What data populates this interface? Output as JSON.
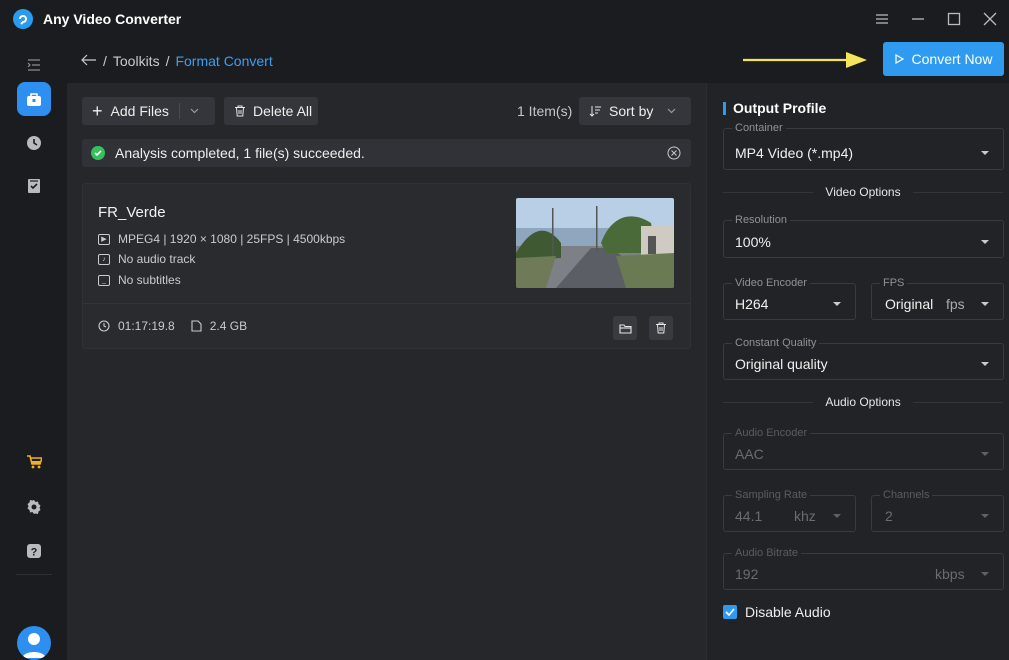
{
  "app": {
    "title": "Any Video Converter"
  },
  "header": {
    "breadcrumb": [
      "Toolkits",
      "Format Convert"
    ],
    "separator": "/",
    "convert_label": "Convert Now"
  },
  "toolbar": {
    "add_files": "Add Files",
    "delete_all": "Delete All",
    "items_count": "1 Item(s)",
    "sort_by": "Sort by"
  },
  "status": {
    "message": "Analysis completed, 1 file(s) succeeded."
  },
  "file": {
    "name": "FR_Verde",
    "video_info": "MPEG4 | 1920 × 1080 | 25FPS | 4500kbps",
    "audio_info": "No audio track",
    "subtitle_info": "No subtitles",
    "duration": "01:17:19.8",
    "size": "2.4 GB"
  },
  "output": {
    "title": "Output Profile",
    "container": {
      "label": "Container",
      "value": "MP4 Video (*.mp4)"
    },
    "video_options_title": "Video Options",
    "resolution": {
      "label": "Resolution",
      "value": "100%"
    },
    "video_encoder": {
      "label": "Video Encoder",
      "value": "H264"
    },
    "fps": {
      "label": "FPS",
      "value": "Original",
      "unit": "fps"
    },
    "quality": {
      "label": "Constant Quality",
      "value": "Original quality"
    },
    "audio_options_title": "Audio Options",
    "audio_encoder": {
      "label": "Audio Encoder",
      "value": "AAC"
    },
    "sampling_rate": {
      "label": "Sampling Rate",
      "value": "44.1",
      "unit": "khz"
    },
    "channels": {
      "label": "Channels",
      "value": "2"
    },
    "audio_bitrate": {
      "label": "Audio Bitrate",
      "value": "192",
      "unit": "kbps"
    },
    "disable_audio": {
      "label": "Disable Audio",
      "checked": true
    }
  },
  "colors": {
    "accent": "#2e9bf0",
    "success": "#35c05a",
    "arrow": "#f3e65a"
  }
}
